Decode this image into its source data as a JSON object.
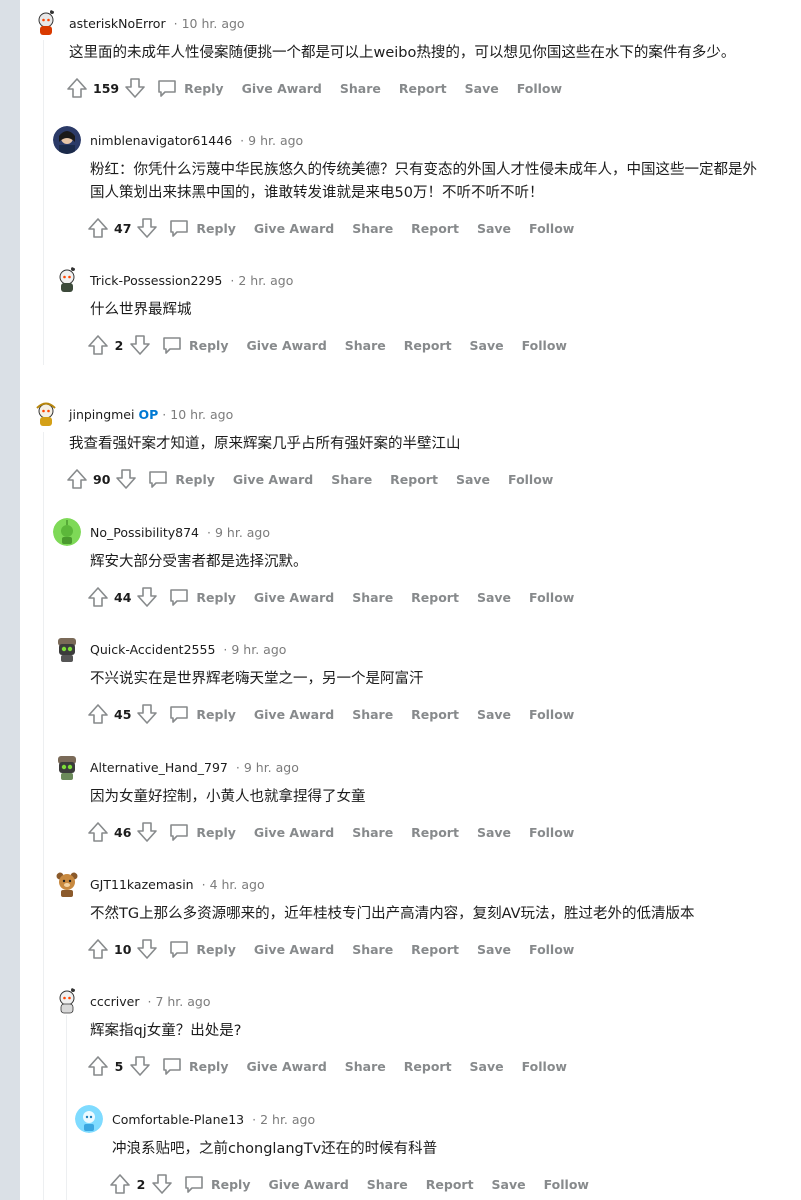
{
  "actions": {
    "reply": "Reply",
    "give_award": "Give Award",
    "share": "Share",
    "report": "Report",
    "save": "Save",
    "follow": "Follow"
  },
  "comments": [
    {
      "username": "asteriskNoError",
      "op_badge": "",
      "time": "10 hr. ago",
      "text": "这里面的未成年人性侵案随便挑一个都是可以上weibo热搜的，可以想见你国这些在水下的案件有多少。",
      "score": "159",
      "avatar_icon": "snoo-avatar-icon"
    },
    {
      "username": "nimblenavigator61446",
      "op_badge": "",
      "time": "9 hr. ago",
      "text": "粉红：你凭什么污蔑中华民族悠久的传统美德？只有变态的外国人才性侵未成年人，中国这些一定都是外国人策划出来抹黑中国的，谁敢转发谁就是来电50万！不听不听不听！",
      "score": "47",
      "avatar_icon": "photo-avatar-icon"
    },
    {
      "username": "Trick-Possession2295",
      "op_badge": "",
      "time": "2 hr. ago",
      "text": "什么世界最辉城",
      "score": "2",
      "avatar_icon": "snoo-avatar-icon"
    },
    {
      "username": "jinpingmei",
      "op_badge": "OP",
      "time": "10 hr. ago",
      "text": "我查看强奸案才知道，原来辉案几乎占所有强奸案的半壁江山",
      "score": "90",
      "avatar_icon": "snoo-avatar-icon"
    },
    {
      "username": "No_Possibility874",
      "op_badge": "",
      "time": "9 hr. ago",
      "text": "辉安大部分受害者都是选择沉默。",
      "score": "44",
      "avatar_icon": "green-snoo-avatar-icon"
    },
    {
      "username": "Quick-Accident2555",
      "op_badge": "",
      "time": "9 hr. ago",
      "text": "不兴说实在是世界辉老嗨天堂之一，另一个是阿富汗",
      "score": "45",
      "avatar_icon": "robot-avatar-icon"
    },
    {
      "username": "Alternative_Hand_797",
      "op_badge": "",
      "time": "9 hr. ago",
      "text": "因为女童好控制，小黄人也就拿捏得了女童",
      "score": "46",
      "avatar_icon": "robot-avatar-icon"
    },
    {
      "username": "GJT11kazemasin",
      "op_badge": "",
      "time": "4 hr. ago",
      "text": "不然TG上那么多资源哪来的，近年桂枝专门出产高清内容，复刻AV玩法，胜过老外的低清版本",
      "score": "10",
      "avatar_icon": "bear-avatar-icon"
    },
    {
      "username": "cccriver",
      "op_badge": "",
      "time": "7 hr. ago",
      "text": "辉案指qj女童？出处是?",
      "score": "5",
      "avatar_icon": "snoo-avatar-icon"
    },
    {
      "username": "Comfortable-Plane13",
      "op_badge": "",
      "time": "2 hr. ago",
      "text": "冲浪系贴吧，之前chonglangTv还在的时候有科普",
      "score": "2",
      "avatar_icon": "blue-snoo-avatar-icon"
    }
  ]
}
